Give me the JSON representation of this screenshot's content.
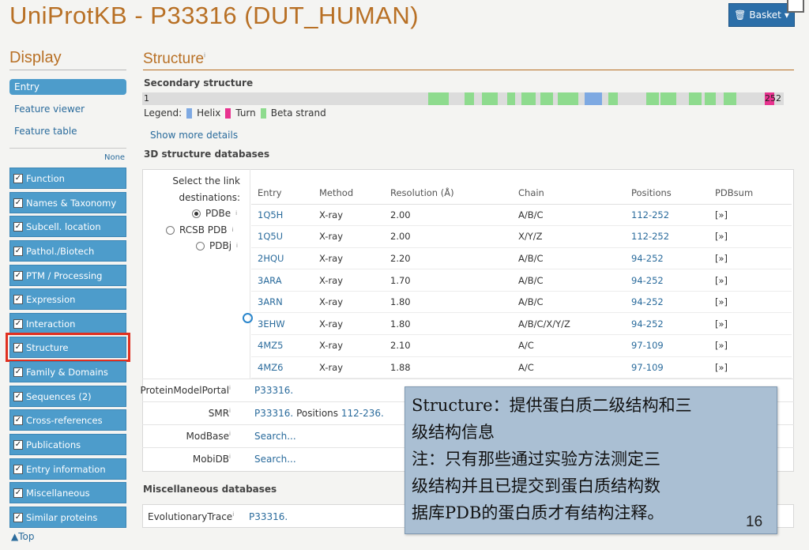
{
  "header": {
    "title": "UniProtKB - P33316 (DUT_HUMAN)",
    "basket_label": "Basket"
  },
  "sidebar": {
    "title": "Display",
    "entry_label": "Entry",
    "links": [
      "Feature viewer",
      "Feature table"
    ],
    "none_label": "None",
    "sections": [
      {
        "label": "Function",
        "checked": true
      },
      {
        "label": "Names & Taxonomy",
        "checked": true
      },
      {
        "label": "Subcell. location",
        "checked": true
      },
      {
        "label": "Pathol./Biotech",
        "checked": true
      },
      {
        "label": "PTM / Processing",
        "checked": true
      },
      {
        "label": "Expression",
        "checked": true
      },
      {
        "label": "Interaction",
        "checked": true
      },
      {
        "label": "Structure",
        "checked": true,
        "highlighted": true
      },
      {
        "label": "Family & Domains",
        "checked": true
      },
      {
        "label": "Sequences (2)",
        "checked": true
      },
      {
        "label": "Cross-references",
        "checked": true
      },
      {
        "label": "Publications",
        "checked": true
      },
      {
        "label": "Entry information",
        "checked": true
      },
      {
        "label": "Miscellaneous",
        "checked": true
      },
      {
        "label": "Similar proteins",
        "checked": true
      }
    ],
    "top_label": "Top"
  },
  "main": {
    "section_title": "Structure",
    "secondary": {
      "heading": "Secondary structure",
      "start": "1",
      "end": "252",
      "legend_label": "Legend:",
      "legend": [
        {
          "label": "Helix",
          "color": "#7ea9e2"
        },
        {
          "label": "Turn",
          "color": "#e8338f"
        },
        {
          "label": "Beta strand",
          "color": "#8edb8e"
        }
      ],
      "show_more": "Show more details"
    },
    "db3d": {
      "heading": "3D structure databases",
      "select_label_1": "Select the link",
      "select_label_2": "destinations:",
      "options": [
        {
          "label": "PDBe",
          "selected": true
        },
        {
          "label": "RCSB PDB",
          "selected": false
        },
        {
          "label": "PDBj",
          "selected": false
        }
      ],
      "columns": [
        "Entry",
        "Method",
        "Resolution (Å)",
        "Chain",
        "Positions",
        "PDBsum"
      ],
      "rows": [
        {
          "entry": "1Q5H",
          "method": "X-ray",
          "resolution": "2.00",
          "chain": "A/B/C",
          "positions": "112-252",
          "pdbsum": "[»]"
        },
        {
          "entry": "1Q5U",
          "method": "X-ray",
          "resolution": "2.00",
          "chain": "X/Y/Z",
          "positions": "112-252",
          "pdbsum": "[»]"
        },
        {
          "entry": "2HQU",
          "method": "X-ray",
          "resolution": "2.20",
          "chain": "A/B/C",
          "positions": "94-252",
          "pdbsum": "[»]"
        },
        {
          "entry": "3ARA",
          "method": "X-ray",
          "resolution": "1.70",
          "chain": "A/B/C",
          "positions": "94-252",
          "pdbsum": "[»]"
        },
        {
          "entry": "3ARN",
          "method": "X-ray",
          "resolution": "1.80",
          "chain": "A/B/C",
          "positions": "94-252",
          "pdbsum": "[»]"
        },
        {
          "entry": "3EHW",
          "method": "X-ray",
          "resolution": "1.80",
          "chain": "A/B/C/X/Y/Z",
          "positions": "94-252",
          "pdbsum": "[»]"
        },
        {
          "entry": "4MZ5",
          "method": "X-ray",
          "resolution": "2.10",
          "chain": "A/C",
          "positions": "97-109",
          "pdbsum": "[»]"
        },
        {
          "entry": "4MZ6",
          "method": "X-ray",
          "resolution": "1.88",
          "chain": "A/C",
          "positions": "97-109",
          "pdbsum": "[»]"
        }
      ],
      "extra": [
        {
          "label": "ProteinModelPortal",
          "value": "P33316."
        },
        {
          "label": "SMR",
          "value": "P33316.",
          "suffix": "Positions",
          "range": "112-236."
        },
        {
          "label": "ModBase",
          "value": "Search..."
        },
        {
          "label": "MobiDB",
          "value": "Search..."
        }
      ]
    },
    "misc": {
      "heading": "Miscellaneous databases",
      "label": "EvolutionaryTrace",
      "value": "P33316."
    }
  },
  "note": {
    "line1": "Structure：提供蛋白质二级结构和三",
    "line2": "级结构信息",
    "line3": "注：只有那些通过实验方法测定三",
    "line4": "级结构并且已提交到蛋白质结构数",
    "line5": "据库PDB的蛋白质才有结构注释。",
    "page": "16"
  }
}
